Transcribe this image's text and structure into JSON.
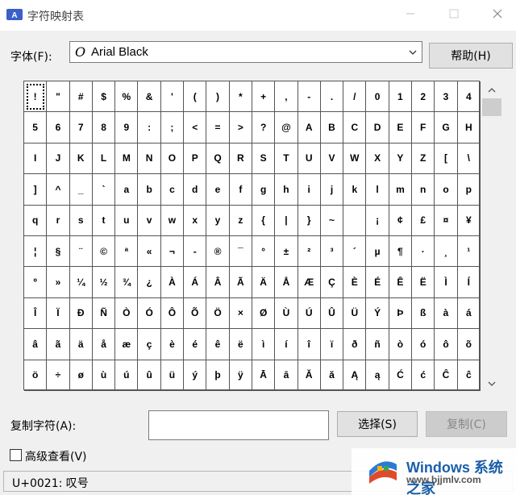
{
  "window": {
    "title": "字符映射表",
    "icon": "charmap-app-icon"
  },
  "font": {
    "label": "字体(F):",
    "selected": "Arial Black",
    "glyph": "O",
    "help_button": "帮助(H)"
  },
  "chars": [
    "!",
    "\"",
    "#",
    "$",
    "%",
    "&",
    "'",
    "(",
    ")",
    "*",
    "+",
    ",",
    "-",
    ".",
    "/",
    "0",
    "1",
    "2",
    "3",
    "4",
    "5",
    "6",
    "7",
    "8",
    "9",
    ":",
    ";",
    "<",
    "=",
    ">",
    "?",
    "@",
    "A",
    "B",
    "C",
    "D",
    "E",
    "F",
    "G",
    "H",
    "I",
    "J",
    "K",
    "L",
    "M",
    "N",
    "O",
    "P",
    "Q",
    "R",
    "S",
    "T",
    "U",
    "V",
    "W",
    "X",
    "Y",
    "Z",
    "[",
    "\\",
    "]",
    "^",
    "_",
    "`",
    "a",
    "b",
    "c",
    "d",
    "e",
    "f",
    "g",
    "h",
    "i",
    "j",
    "k",
    "l",
    "m",
    "n",
    "o",
    "p",
    "q",
    "r",
    "s",
    "t",
    "u",
    "v",
    "w",
    "x",
    "y",
    "z",
    "{",
    "|",
    "}",
    "~",
    " ",
    "¡",
    "¢",
    "£",
    "¤",
    "¥",
    "¦",
    "§",
    "¨",
    "©",
    "ª",
    "«",
    "¬",
    "-",
    "®",
    "¯",
    "°",
    "±",
    "²",
    "³",
    "´",
    "µ",
    "¶",
    "·",
    "¸",
    "¹",
    "º",
    "»",
    "¼",
    "½",
    "¾",
    "¿",
    "À",
    "Á",
    "Â",
    "Ã",
    "Ä",
    "Å",
    "Æ",
    "Ç",
    "È",
    "É",
    "Ê",
    "Ë",
    "Ì",
    "Í",
    "Î",
    "Ï",
    "Ð",
    "Ñ",
    "Ò",
    "Ó",
    "Ô",
    "Õ",
    "Ö",
    "×",
    "Ø",
    "Ù",
    "Ú",
    "Û",
    "Ü",
    "Ý",
    "Þ",
    "ß",
    "à",
    "á",
    "â",
    "ã",
    "ä",
    "å",
    "æ",
    "ç",
    "è",
    "é",
    "ê",
    "ë",
    "ì",
    "í",
    "î",
    "ï",
    "ð",
    "ñ",
    "ò",
    "ó",
    "ô",
    "õ",
    "ö",
    "÷",
    "ø",
    "ù",
    "ú",
    "û",
    "ü",
    "ý",
    "þ",
    "ÿ",
    "Ā",
    "ā",
    "Ă",
    "ă",
    "Ą",
    "ą",
    "Ć",
    "ć",
    "Ĉ",
    "ĉ"
  ],
  "copy": {
    "label": "复制字符(A):",
    "value": "",
    "select_button": "选择(S)",
    "copy_button": "复制(C)"
  },
  "advanced": {
    "label": "高级查看(V)",
    "checked": false
  },
  "status": "U+0021: 叹号",
  "watermark": {
    "brand": "Windows 系统之家",
    "site": "www.bjjmlv.com"
  }
}
